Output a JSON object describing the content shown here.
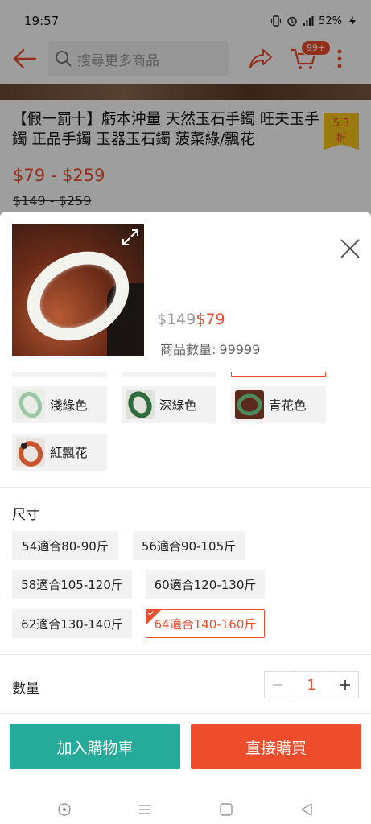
{
  "status_bar": {
    "time": "19:57",
    "battery": "52%"
  },
  "header": {
    "search_placeholder": "搜尋更多商品",
    "cart_badge": "99+"
  },
  "product": {
    "title": "【假一罰十】虧本沖量 天然玉石手鐲 旺夫玉手鐲 正品手鐲 玉器玉石鐲 菠菜綠/飄花",
    "discount_line1": "5.3",
    "discount_line2": "折",
    "price_range": "$79 - $259",
    "original_range": "$149 - $259"
  },
  "sheet": {
    "price_original": "$149",
    "price_current": "$79",
    "stock_label": "商品數量:",
    "stock_value": "99999",
    "colors": [
      {
        "label": "淺綠色",
        "swatch": "#8fbf9a"
      },
      {
        "label": "深綠色",
        "swatch": "#2f6b3c"
      },
      {
        "label": "青花色",
        "swatch": "#3a7a52"
      },
      {
        "label": "紅飄花",
        "swatch": "#c9542d"
      }
    ],
    "size_label": "尺寸",
    "sizes": [
      {
        "label": "54適合80-90斤",
        "selected": false
      },
      {
        "label": "56適合90-105斤",
        "selected": false
      },
      {
        "label": "58適合105-120斤",
        "selected": false
      },
      {
        "label": "60適合120-130斤",
        "selected": false
      },
      {
        "label": "62適合130-140斤",
        "selected": false
      },
      {
        "label": "64適合140-160斤",
        "selected": true
      }
    ],
    "quantity_label": "數量",
    "quantity_value": "1",
    "add_to_cart": "加入購物車",
    "buy_now": "直接購買"
  },
  "colors": {
    "accent": "#ee4d2d",
    "cart_button": "#26aa99",
    "discount_tag": "#f5c518"
  }
}
